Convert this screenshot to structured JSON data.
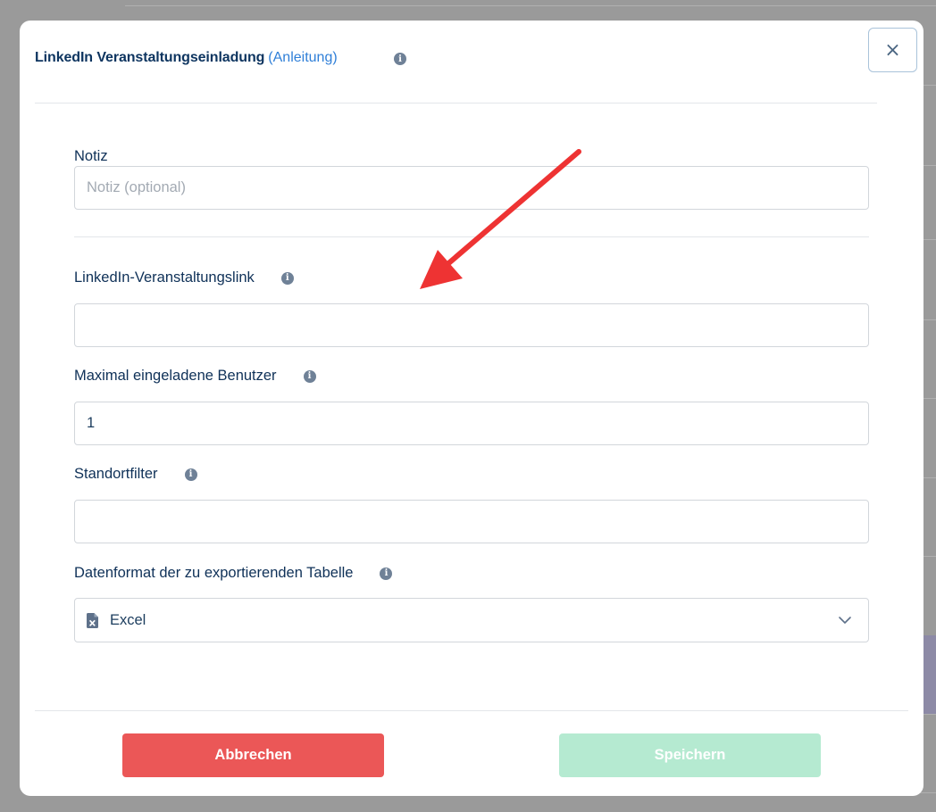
{
  "modal": {
    "title": "LinkedIn Veranstaltungseinladung",
    "guide_link": "(Anleitung)",
    "close_label": "×"
  },
  "fields": {
    "note": {
      "label": "Notiz",
      "placeholder": "Notiz (optional)",
      "value": ""
    },
    "event_link": {
      "label": "LinkedIn-Veranstaltungslink",
      "value": ""
    },
    "max_users": {
      "label": "Maximal eingeladene Benutzer",
      "value": "1"
    },
    "location_filter": {
      "label": "Standortfilter",
      "value": ""
    },
    "export_format": {
      "label": "Datenformat der zu exportierenden Tabelle",
      "selected": "Excel",
      "icon": "excel-file-icon"
    }
  },
  "footer": {
    "cancel_label": "Abbrechen",
    "save_label": "Speichern"
  },
  "colors": {
    "cancel": "#eb5757",
    "save_disabled": "#b5ead1",
    "accent_link": "#2f7fd8",
    "annotation_arrow": "#ee3333"
  },
  "info_icon_glyph": "i"
}
